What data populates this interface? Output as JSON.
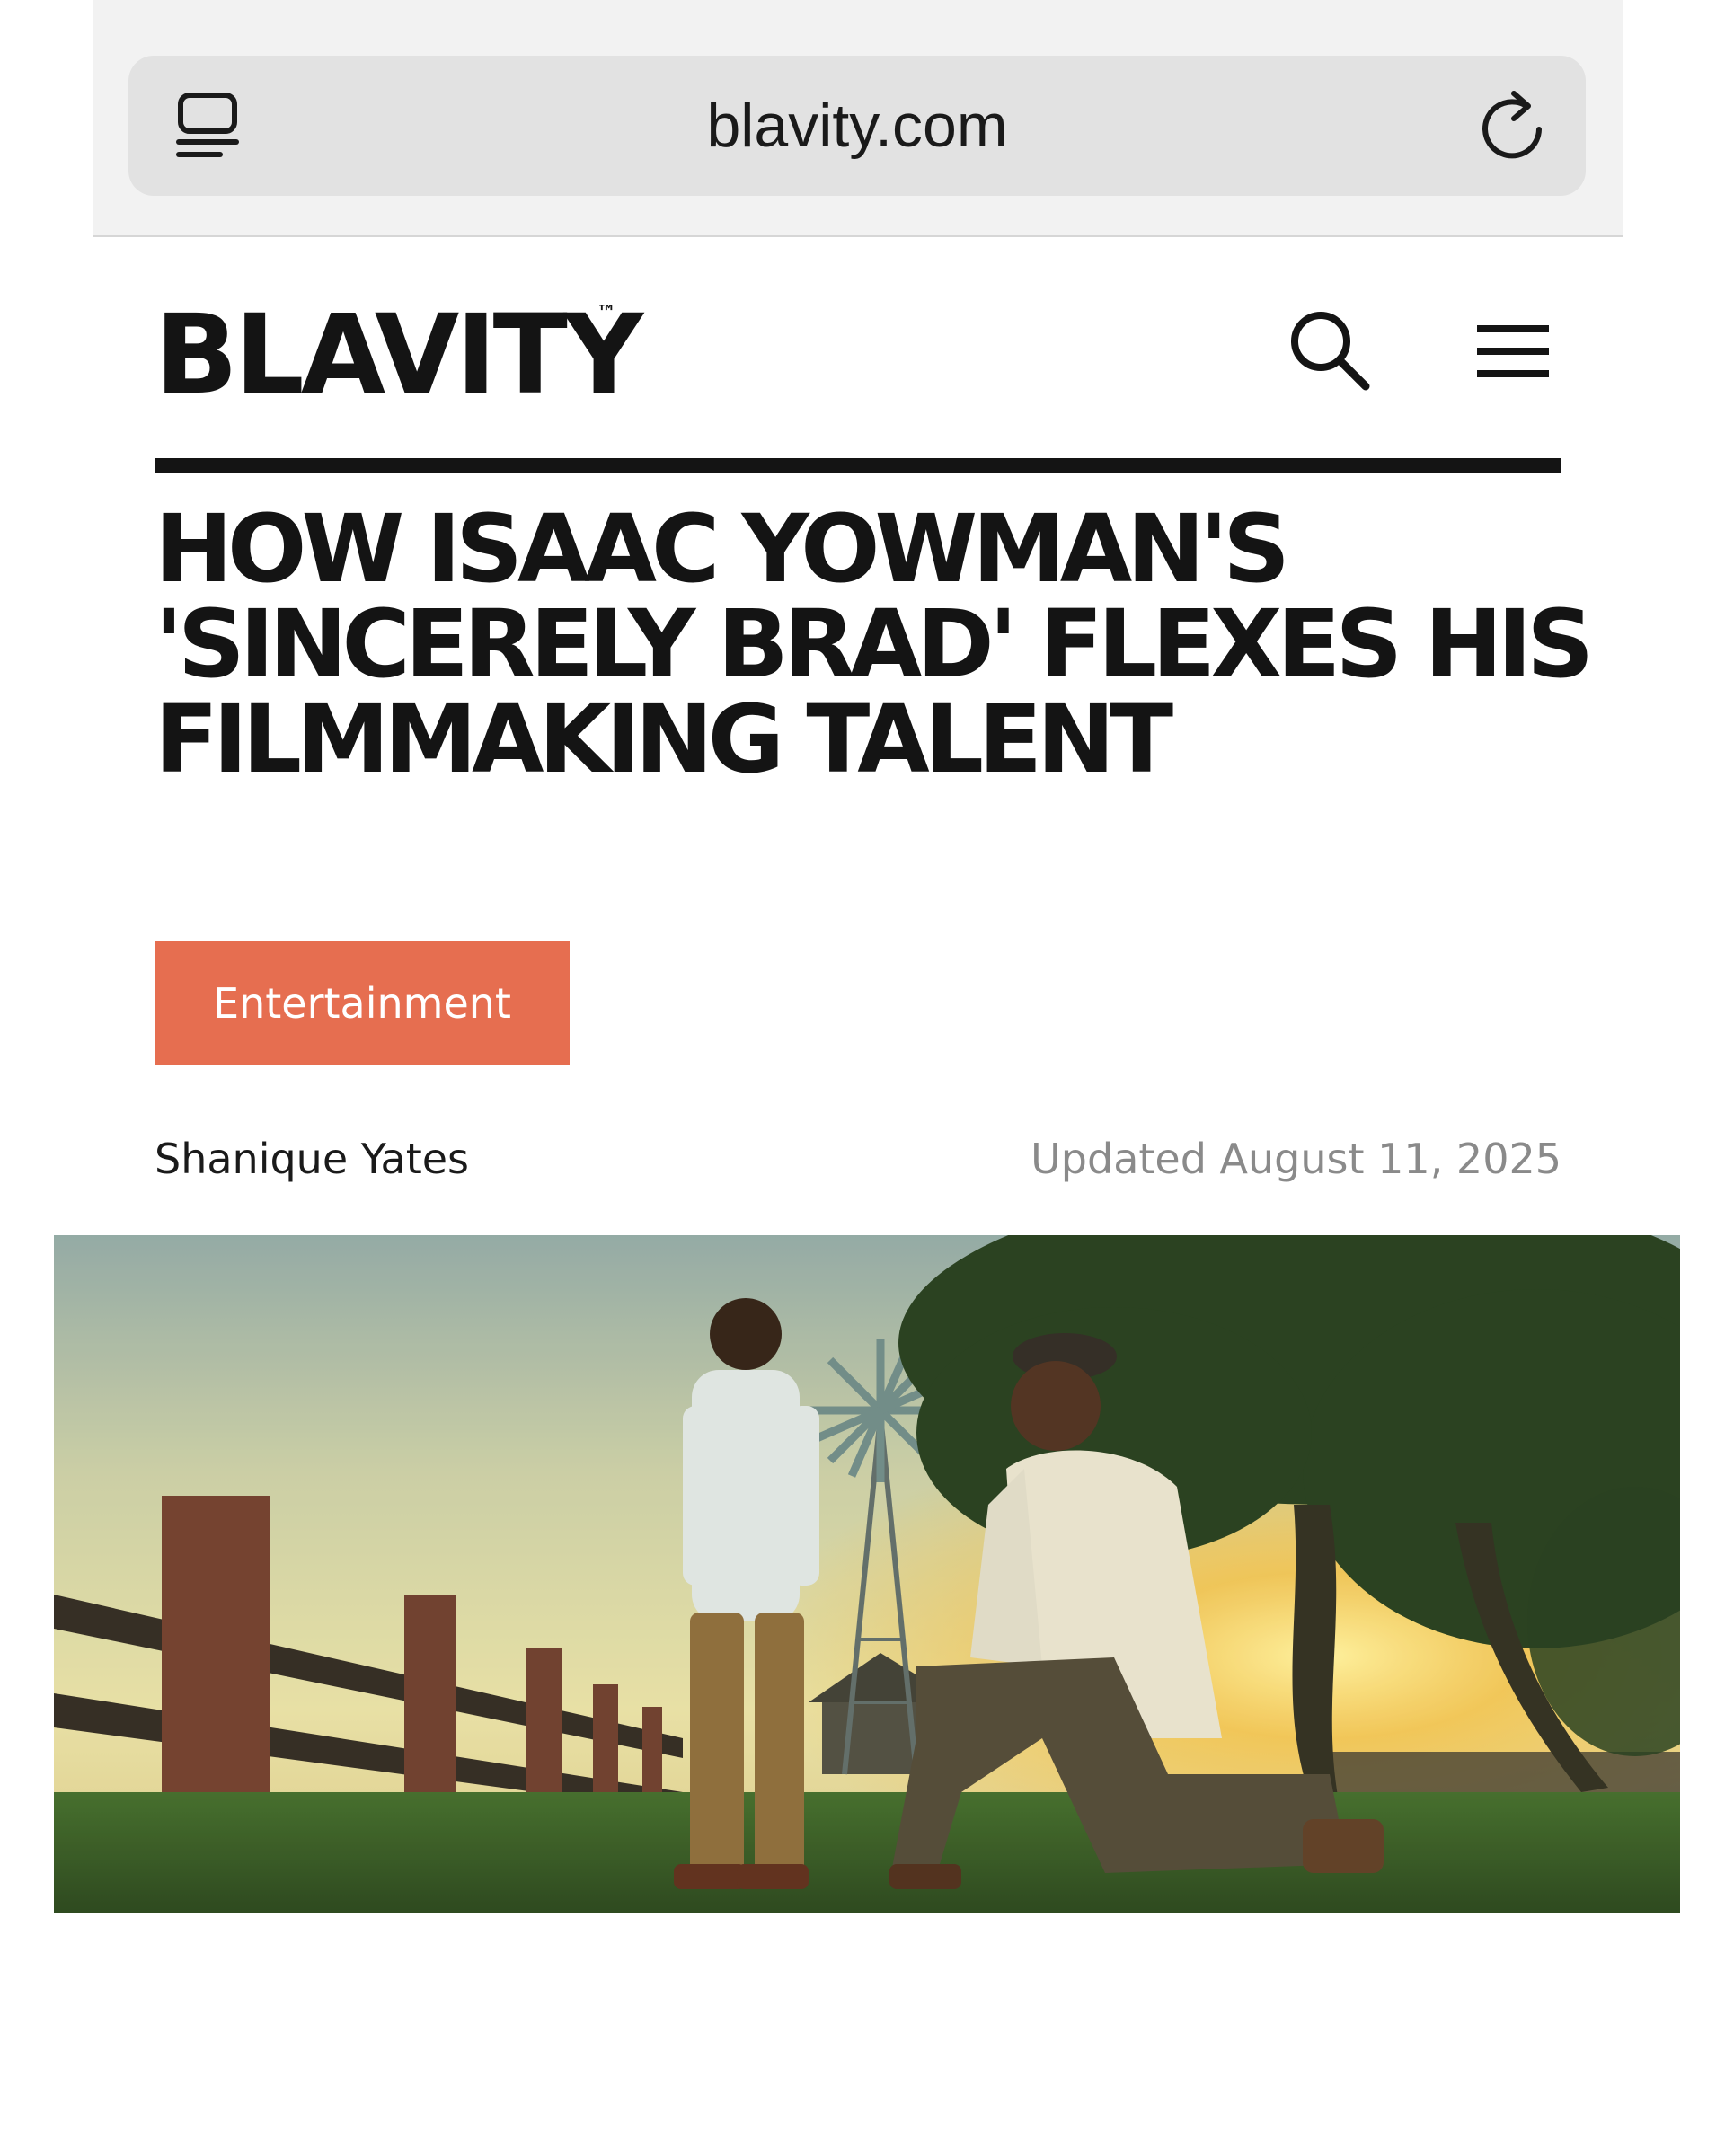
{
  "browser": {
    "url": "blavity.com",
    "tabs_icon": "tabs-icon",
    "reload_icon": "reload-icon"
  },
  "site": {
    "logo": "BLAVITY",
    "logo_mark": "™",
    "search_icon": "search-icon",
    "menu_icon": "hamburger-menu-icon"
  },
  "article": {
    "headline": "HOW ISAAC YOWMAN'S 'SINCERELY BRAD' FLEXES HIS FILMMAKING TALENT",
    "category": "Entertainment",
    "author": "Shanique Yates",
    "updated": "Updated August 11, 2025",
    "hero_image": "film still: boy standing and man kneeling in a field at sunset, with wooden fence and windmill"
  },
  "colors": {
    "accent": "#e66e50",
    "text": "#141414",
    "muted": "#8a8a8a",
    "chrome_bg": "#f2f2f2",
    "url_bar_bg": "#e2e2e2"
  }
}
